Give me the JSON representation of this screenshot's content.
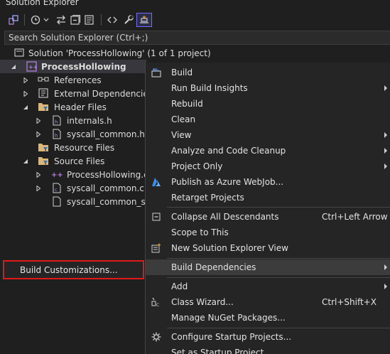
{
  "window": {
    "title": "Solution Explorer"
  },
  "toolbar": {
    "icons": [
      "switch-views-icon",
      "history-icon",
      "sync-icon",
      "collapse-all-icon",
      "show-all-files-icon",
      "code-view-icon",
      "properties-wrench-icon",
      "preview-selected-icon"
    ]
  },
  "search": {
    "placeholder": "Search Solution Explorer (Ctrl+;)"
  },
  "tree": {
    "solution_label": "Solution 'ProcessHollowing' (1 of 1 project)",
    "project_label": "ProcessHollowing",
    "references": "References",
    "external_deps": "External Dependencies",
    "header_files": "Header Files",
    "internals_h": "internals.h",
    "syscall_common_h": "syscall_common.h",
    "resource_files": "Resource Files",
    "source_files": "Source Files",
    "processhollowing_cpp": "ProcessHollowing.cp",
    "syscall_common_c": "syscall_common.c",
    "syscall_common_stub": "syscall_common_stul"
  },
  "popup": {
    "build_customizations": "Build Customizations..."
  },
  "context_menu": {
    "build": "Build",
    "run_build_insights": "Run Build Insights",
    "rebuild": "Rebuild",
    "clean": "Clean",
    "view": "View",
    "analyze": "Analyze and Code Cleanup",
    "project_only": "Project Only",
    "publish_azure": "Publish as Azure WebJob...",
    "retarget": "Retarget Projects",
    "collapse_all": "Collapse All Descendants",
    "collapse_all_shortcut": "Ctrl+Left Arrow",
    "scope_to_this": "Scope to This",
    "new_view": "New Solution Explorer View",
    "build_dependencies": "Build Dependencies",
    "add": "Add",
    "class_wizard": "Class Wizard...",
    "class_wizard_shortcut": "Ctrl+Shift+X",
    "manage_nuget": "Manage NuGet Packages...",
    "configure_startup": "Configure Startup Projects...",
    "set_startup": "Set as Startup Project"
  },
  "colors": {
    "background": "#1f1f1f",
    "menu_background": "#252526",
    "highlight_border": "#e01818",
    "accent_purple": "#b180d7",
    "folder_yellow": "#dcb67a"
  }
}
